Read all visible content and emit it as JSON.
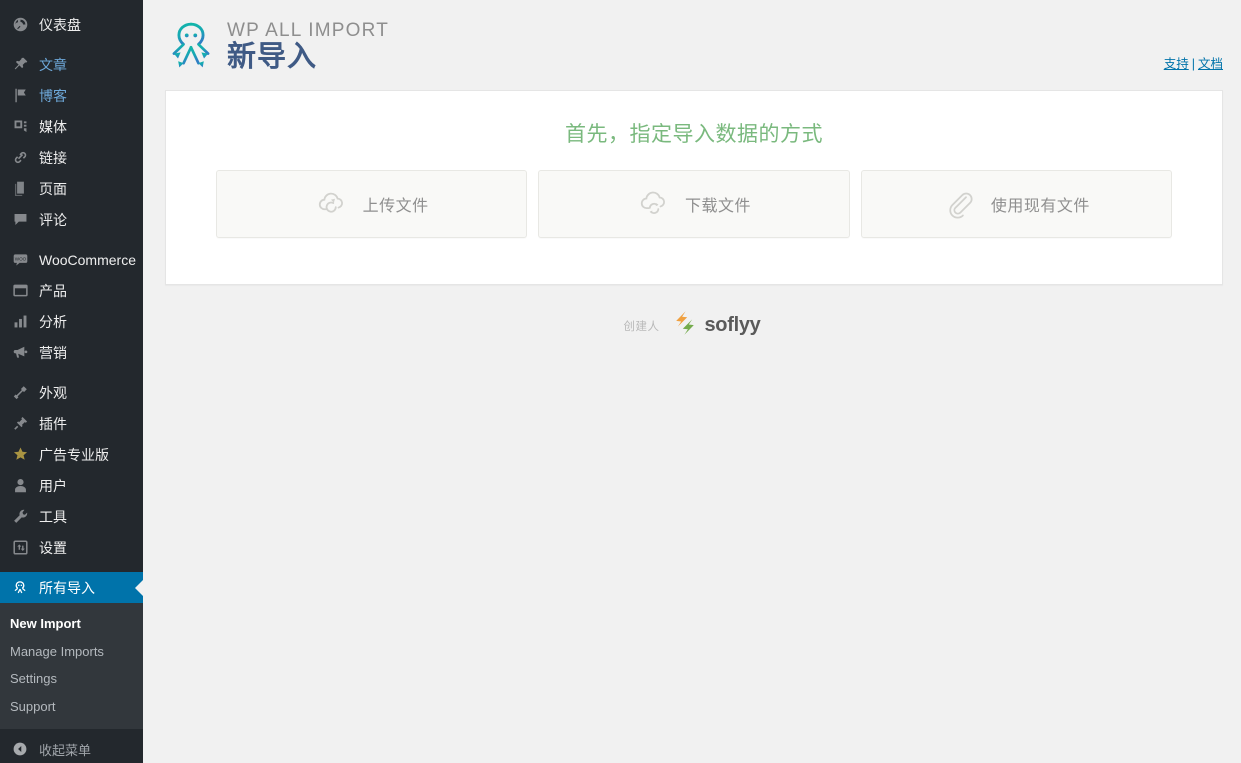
{
  "sidebar": {
    "items": [
      {
        "label": "仪表盘",
        "icon": "dashboard-icon",
        "group": 0,
        "style": "plain"
      },
      {
        "label": "文章",
        "icon": "pin-icon",
        "group": 1,
        "style": "link-blue"
      },
      {
        "label": "博客",
        "icon": "flag-icon",
        "group": 1,
        "style": "link-blue"
      },
      {
        "label": "媒体",
        "icon": "media-icon",
        "group": 1,
        "style": "plain"
      },
      {
        "label": "链接",
        "icon": "link-icon",
        "group": 1,
        "style": "plain"
      },
      {
        "label": "页面",
        "icon": "page-icon",
        "group": 1,
        "style": "plain"
      },
      {
        "label": "评论",
        "icon": "comment-icon",
        "group": 1,
        "style": "plain"
      },
      {
        "label": "WooCommerce",
        "icon": "woo-icon",
        "group": 2,
        "style": "plain"
      },
      {
        "label": "产品",
        "icon": "product-icon",
        "group": 2,
        "style": "plain"
      },
      {
        "label": "分析",
        "icon": "analytics-icon",
        "group": 2,
        "style": "plain"
      },
      {
        "label": "营销",
        "icon": "megaphone-icon",
        "group": 2,
        "style": "plain"
      },
      {
        "label": "外观",
        "icon": "appearance-icon",
        "group": 3,
        "style": "plain"
      },
      {
        "label": "插件",
        "icon": "plugin-icon",
        "group": 3,
        "style": "plain"
      },
      {
        "label": "广告专业版",
        "icon": "star-icon",
        "group": 3,
        "style": "plain"
      },
      {
        "label": "用户",
        "icon": "user-icon",
        "group": 3,
        "style": "plain"
      },
      {
        "label": "工具",
        "icon": "wrench-icon",
        "group": 3,
        "style": "plain"
      },
      {
        "label": "设置",
        "icon": "settings-icon",
        "group": 3,
        "style": "plain"
      }
    ],
    "active_item": {
      "label": "所有导入",
      "icon": "octopus-icon"
    },
    "submenu": [
      {
        "label": "New Import",
        "current": true
      },
      {
        "label": "Manage Imports",
        "current": false
      },
      {
        "label": "Settings",
        "current": false
      },
      {
        "label": "Support",
        "current": false
      }
    ],
    "collapse": {
      "label": "收起菜单",
      "icon": "collapse-left-icon"
    },
    "colors": {
      "bg": "#23282d",
      "submenu_bg": "#32373c",
      "active": "#0073aa",
      "link": "#6da7d8"
    }
  },
  "header": {
    "logo_top": "WP ALL IMPORT",
    "logo_bottom": "新导入",
    "logo_icon": "octopus-logo-icon",
    "support_link": "支持",
    "separator": "|",
    "docs_link": "文档",
    "colors": {
      "logo_top": "#8e8e8e",
      "logo_bottom": "#3f5a85",
      "octopus": "#18b3a7",
      "link": "#0073aa"
    }
  },
  "card": {
    "title": "首先，指定导入数据的方式",
    "title_color": "#7ab97e",
    "choices": [
      {
        "label": "上传文件",
        "icon": "cloud-upload-icon"
      },
      {
        "label": "下载文件",
        "icon": "cloud-download-icon"
      },
      {
        "label": "使用现有文件",
        "icon": "paperclip-icon"
      }
    ]
  },
  "footer": {
    "by_label": "创建人",
    "brand": "soflyy",
    "brand_icon": "soflyy-mark-icon",
    "colors": {
      "mark_orange": "#f0a040",
      "mark_green": "#74ab4c",
      "word": "#5a5a5a"
    }
  }
}
